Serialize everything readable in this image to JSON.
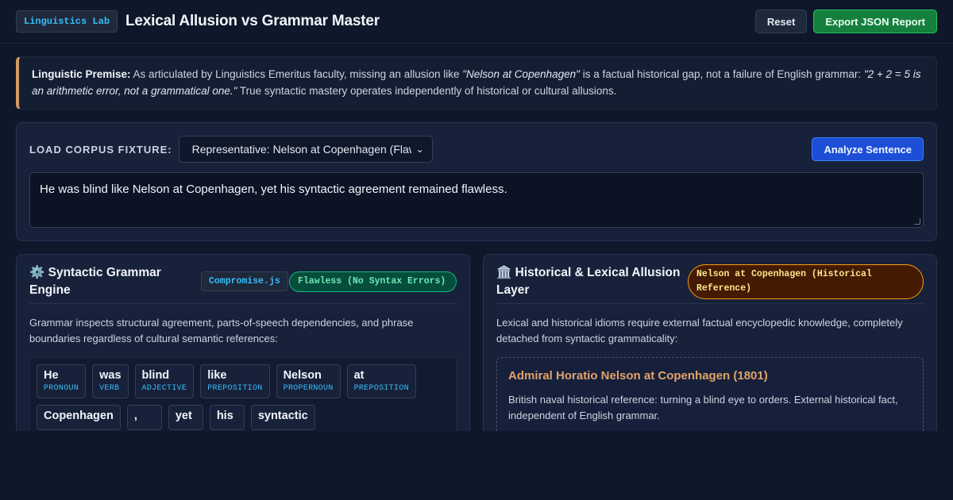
{
  "header": {
    "badge": "Linguistics Lab",
    "title": "Lexical Allusion vs Grammar Master",
    "reset_label": "Reset",
    "export_label": "Export JSON Report"
  },
  "premise": {
    "lead": "Linguistic Premise:",
    "text1": " As articulated by Linguistics Emeritus faculty, missing an allusion like ",
    "quote1": "\"Nelson at Copenhagen\"",
    "text2": " is a factual historical gap, not a failure of English grammar: ",
    "quote2": "\"2 + 2 = 5 is an arithmetic error, not a grammatical one.\"",
    "text3": " True syntactic mastery operates independently of historical or cultural allusions."
  },
  "corpus": {
    "label": "LOAD CORPUS FIXTURE:",
    "selected": "Representative: Nelson at Copenhagen (Flawless)",
    "analyze_label": "Analyze Sentence",
    "sentence": "He was blind like Nelson at Copenhagen, yet his syntactic agreement remained flawless."
  },
  "grammar": {
    "icon": "gear-icon",
    "icon_glyph": "⚙️",
    "title": "Syntactic Grammar Engine",
    "library": "Compromise.js",
    "status": "Flawless (No Syntax Errors)",
    "description": "Grammar inspects structural agreement, parts-of-speech dependencies, and phrase boundaries regardless of cultural semantic references:",
    "tokens": [
      {
        "word": "He",
        "pos": "PRONOUN"
      },
      {
        "word": "was",
        "pos": "VERB"
      },
      {
        "word": "blind",
        "pos": "ADJECTIVE"
      },
      {
        "word": "like",
        "pos": "PREPOSITION"
      },
      {
        "word": "Nelson",
        "pos": "PROPERNOUN"
      },
      {
        "word": "at",
        "pos": "PREPOSITION"
      },
      {
        "word": "Copenhagen",
        "pos": ""
      },
      {
        "word": ",",
        "pos": ""
      },
      {
        "word": "yet",
        "pos": ""
      },
      {
        "word": "his",
        "pos": ""
      },
      {
        "word": "syntactic",
        "pos": ""
      }
    ]
  },
  "allusion": {
    "icon": "museum-icon",
    "icon_glyph": "🏛️",
    "title": "Historical & Lexical Allusion Layer",
    "status": "Nelson at Copenhagen (Historical Reference)",
    "description": "Lexical and historical idioms require external factual encyclopedic knowledge, completely detached from syntactic grammaticality:",
    "card_title": "Admiral Horatio Nelson at Copenhagen (1801)",
    "card_text": "British naval historical reference: turning a blind eye to orders. External historical fact, independent of English grammar."
  },
  "colors": {
    "background": "#0f172a",
    "accent_blue": "#1d4ed8",
    "accent_green": "#15803d",
    "accent_amber": "#d39a62"
  }
}
